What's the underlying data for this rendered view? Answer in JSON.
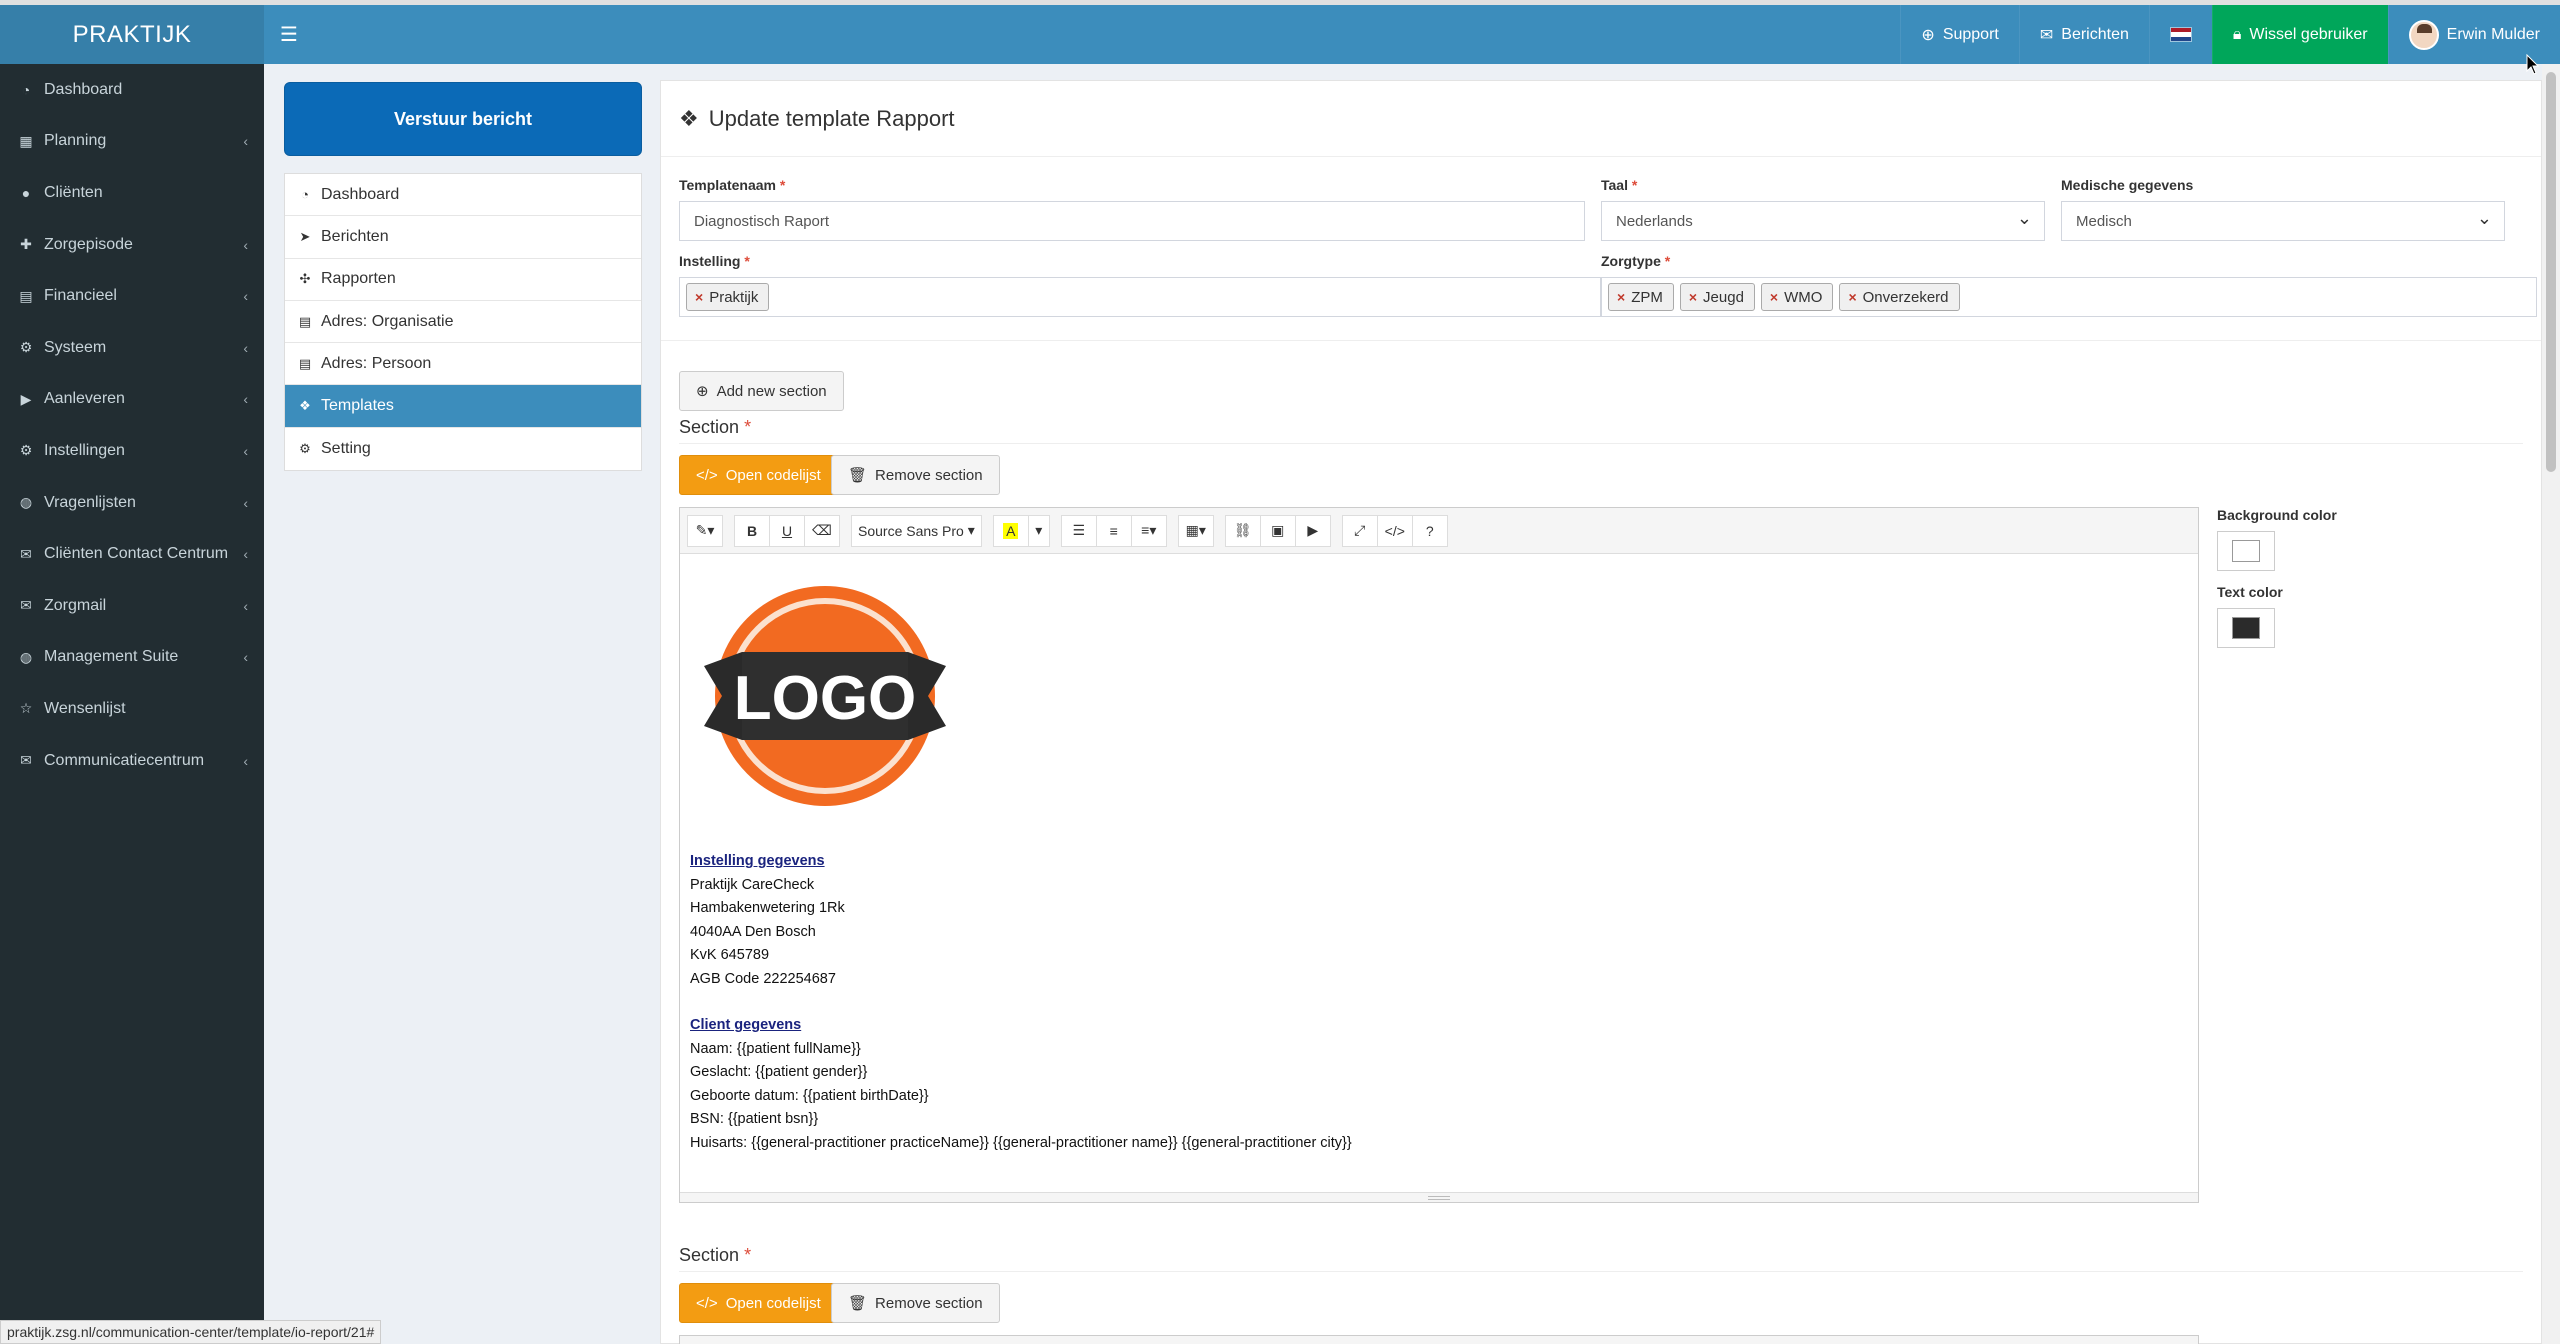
{
  "app": {
    "brand": "PRAKTIJK"
  },
  "topbar": {
    "support": "Support",
    "berichten": "Berichten",
    "switch_user": "Wissel gebruiker",
    "user_name": "Erwin Mulder"
  },
  "sidebar": {
    "items": [
      {
        "label": "Dashboard",
        "icon": "dashboard-icon",
        "glyph": "◔",
        "chevron": false
      },
      {
        "label": "Planning",
        "icon": "calendar-icon",
        "glyph": "▦",
        "chevron": true
      },
      {
        "label": "Cliënten",
        "icon": "user-icon",
        "glyph": "●",
        "chevron": false
      },
      {
        "label": "Zorgepisode",
        "icon": "medkit-icon",
        "glyph": "✚",
        "chevron": true
      },
      {
        "label": "Financieel",
        "icon": "book-icon",
        "glyph": "▤",
        "chevron": true
      },
      {
        "label": "Systeem",
        "icon": "cogs-icon",
        "glyph": "⚙",
        "chevron": true
      },
      {
        "label": "Aanleveren",
        "icon": "truck-icon",
        "glyph": "▶",
        "chevron": true
      },
      {
        "label": "Instellingen",
        "icon": "gear-icon",
        "glyph": "⚙",
        "chevron": true
      },
      {
        "label": "Vragenlijsten",
        "icon": "globe-icon",
        "glyph": "◍",
        "chevron": true
      },
      {
        "label": "Cliënten Contact Centrum",
        "icon": "envelope-icon",
        "glyph": "✉",
        "chevron": true
      },
      {
        "label": "Zorgmail",
        "icon": "envelope-icon",
        "glyph": "✉",
        "chevron": true
      },
      {
        "label": "Management Suite",
        "icon": "globe-icon",
        "glyph": "◍",
        "chevron": true
      },
      {
        "label": "Wensenlijst",
        "icon": "star-icon",
        "glyph": "☆",
        "chevron": false
      },
      {
        "label": "Communicatiecentrum",
        "icon": "envelope-icon",
        "glyph": "✉",
        "chevron": true
      }
    ]
  },
  "subnav": {
    "send_button": "Verstuur bericht",
    "items": [
      {
        "label": "Dashboard",
        "icon": "dashboard-icon",
        "glyph": "◔"
      },
      {
        "label": "Berichten",
        "icon": "paper-plane-icon",
        "glyph": "➤"
      },
      {
        "label": "Rapporten",
        "icon": "puzzle-icon",
        "glyph": "✣"
      },
      {
        "label": "Adres: Organisatie",
        "icon": "book-icon",
        "glyph": "▤"
      },
      {
        "label": "Adres: Persoon",
        "icon": "book-icon",
        "glyph": "▤"
      },
      {
        "label": "Templates",
        "icon": "cubes-icon",
        "glyph": "❖"
      },
      {
        "label": "Setting",
        "icon": "cogs-icon",
        "glyph": "⚙"
      }
    ],
    "active_index": 5
  },
  "form": {
    "title": "Update template Rapport",
    "templatenaam_label": "Templatenaam",
    "templatenaam_value": "Diagnostisch Raport",
    "taal_label": "Taal",
    "taal_value": "Nederlands",
    "medische_label": "Medische gegevens",
    "medische_value": "Medisch",
    "instelling_label": "Instelling",
    "instelling_tags": [
      "Praktijk"
    ],
    "zorgtype_label": "Zorgtype",
    "zorgtype_tags": [
      "ZPM",
      "Jeugd",
      "WMO",
      "Onverzekerd"
    ],
    "add_section": "Add new section"
  },
  "section": {
    "label": "Section",
    "open_codelijst": "Open codelijst",
    "remove_section": "Remove section",
    "background_color_label": "Background color",
    "text_color_label": "Text color",
    "background_color": "#ffffff",
    "text_color": "#2b2b2b",
    "toolbar": {
      "font_name": "Source Sans Pro"
    }
  },
  "editor_content": {
    "logo_text": "LOGO",
    "instelling_heading": "Instelling gegevens",
    "instelling_lines": [
      "Praktijk CareCheck",
      "Hambakenwetering 1Rk",
      "4040AA Den Bosch",
      "KvK 645789",
      "AGB Code 222254687"
    ],
    "client_heading": "Client gegevens",
    "client_lines": [
      "Naam: {{patient fullName}}",
      "Geslacht: {{patient gender}}",
      "Geboorte datum: {{patient birthDate}}",
      "BSN: {{patient bsn}}",
      "Huisarts: {{general-practitioner practiceName}} {{general-practitioner name}} {{general-practitioner city}}"
    ]
  },
  "section2": {
    "label": "Section",
    "open_codelijst": "Open codelijst",
    "remove_section": "Remove section"
  },
  "status_bar": {
    "url": "praktijk.zsg.nl/communication-center/template/io-report/21#"
  },
  "colors": {
    "header": "#3c8dbc",
    "sidebar": "#222d32",
    "accent_green": "#00a65a",
    "accent_orange": "#f39c12",
    "primary_button": "#0b6ab7"
  }
}
